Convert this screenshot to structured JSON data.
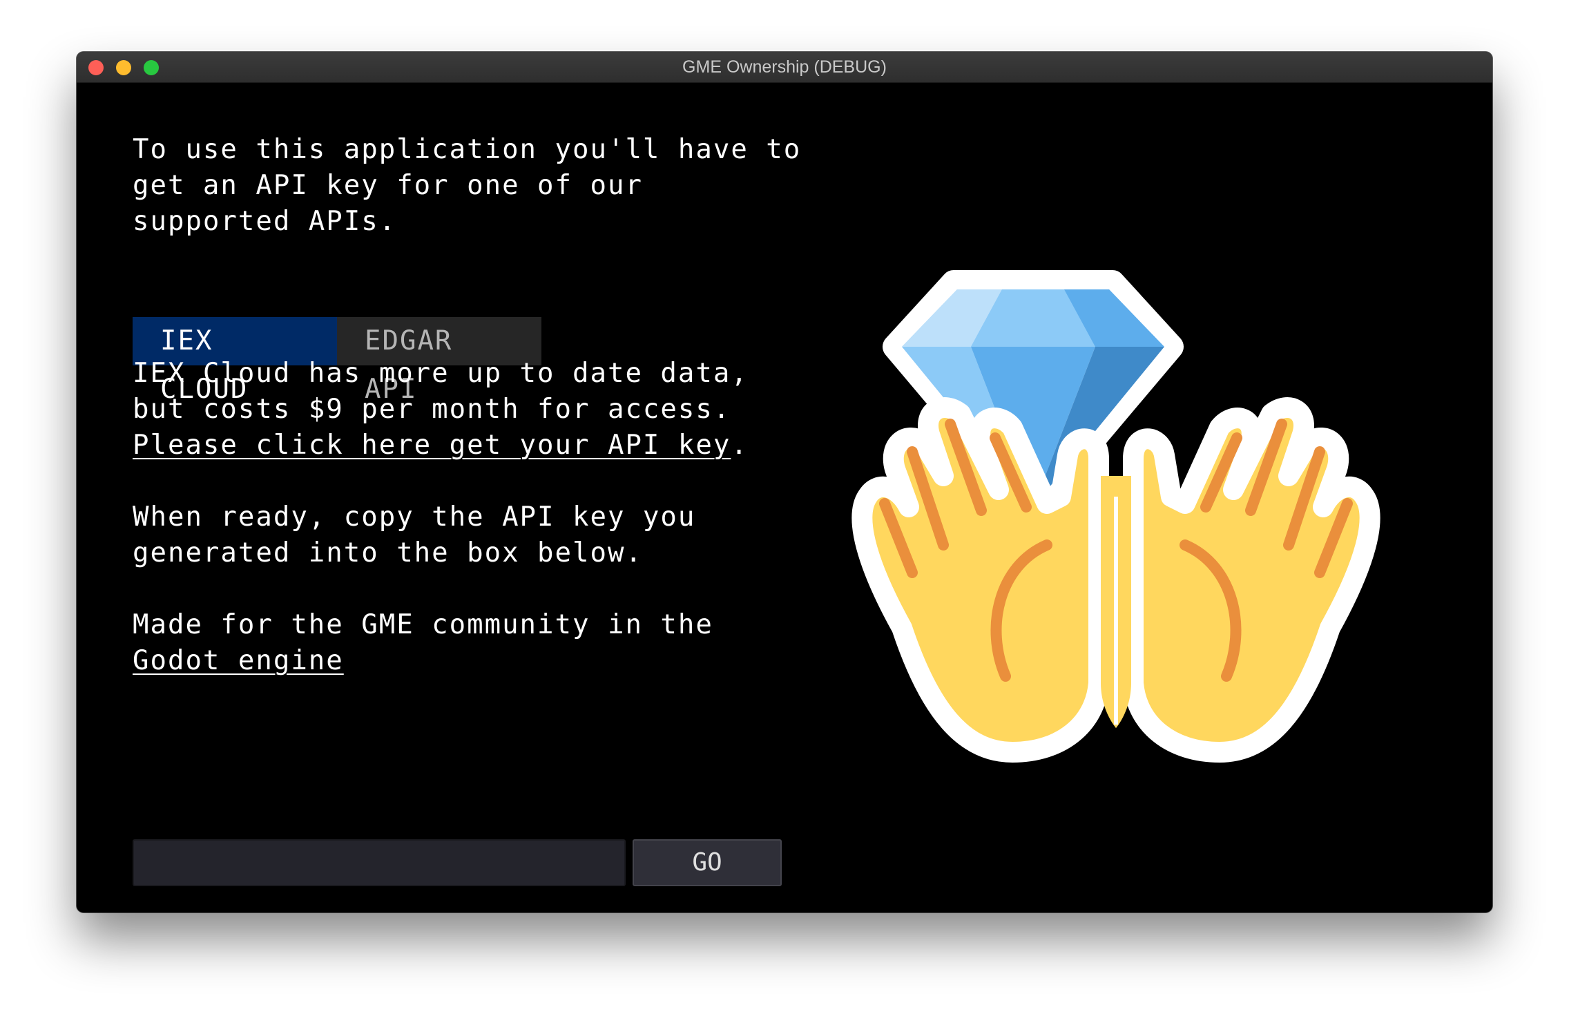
{
  "window": {
    "title": "GME Ownership (DEBUG)"
  },
  "intro": {
    "line1": "To use this application you'll have to",
    "line2": "get an API key for one of our",
    "line3": "supported APIs."
  },
  "tabs": [
    {
      "label": "IEX CLOUD",
      "active": true
    },
    {
      "label": "EDGAR API",
      "active": false
    }
  ],
  "description": {
    "line1": "IEX Cloud has more up to date data,",
    "line2": "but costs $9 per month for access."
  },
  "api_link": {
    "text": "Please click here get your API key",
    "suffix": "."
  },
  "instructions": {
    "line1": "When ready, copy the API key you",
    "line2": "generated into the box below."
  },
  "credits": {
    "line1": "Made for the GME community in the",
    "engine_link": "Godot engine"
  },
  "api_key_input": {
    "value": "",
    "placeholder": ""
  },
  "go_button": {
    "label": "GO"
  },
  "artwork": {
    "icon": "diamond-hands-icon",
    "colors": {
      "diamond_light": "#bde0fa",
      "diamond_mid": "#5dadec",
      "diamond_dark": "#3f8ac9",
      "hand": "#ffd75e",
      "hand_line": "#ea8f3c",
      "outline": "#ffffff"
    }
  }
}
